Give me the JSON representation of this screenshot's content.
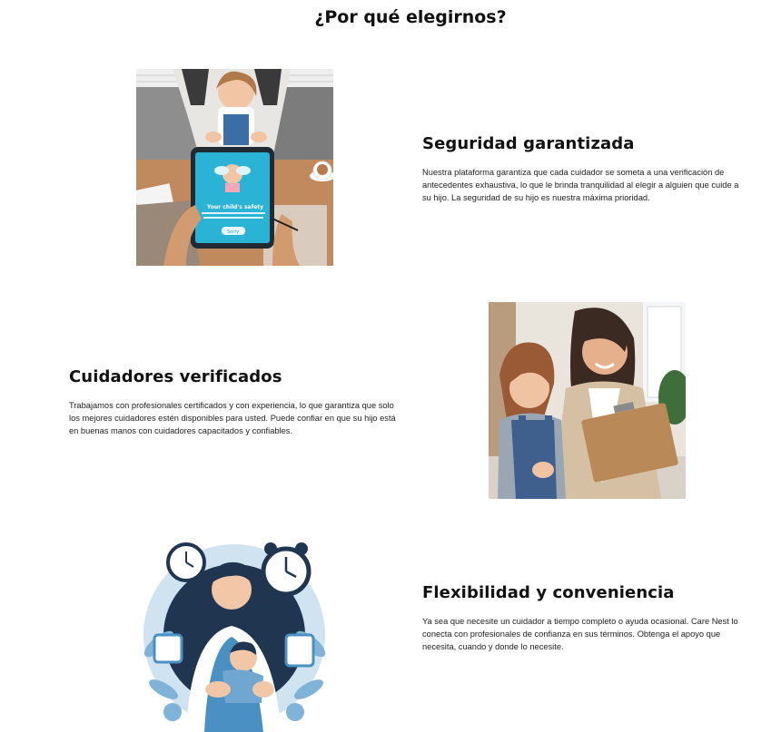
{
  "section": {
    "title": "¿Por qué elegirnos?"
  },
  "features": [
    {
      "heading": "Seguridad garantizada",
      "text": "Nuestra plataforma garantiza que cada cuidador se someta a una verificación de antecedentes exhaustiva, lo que le brinda tranquilidad al elegir a alguien que cuide a su hijo. La seguridad de su hijo es nuestra máxima prioridad.",
      "image": "parent-tablet-child-safety-photo",
      "tablet_text": {
        "title": "Your child's safety",
        "button": "Sorry"
      }
    },
    {
      "heading": "Cuidadores verificados",
      "text": "Trabajamos con profesionales certificados y con experiencia, lo que garantiza que solo los mejores cuidadores estén disponibles para usted. Puede confiar en que su hijo está en buenas manos con cuidadores capacitados y confiables.",
      "image": "caregiver-with-clipboard-and-girl-photo"
    },
    {
      "heading": "Flexibilidad y conveniencia",
      "text": "Ya sea que necesite un cuidador a tiempo completo o ayuda ocasional. Care Nest lo conecta con profesionales de confianza en sus términos. Obtenga el apoyo que necesita, cuando y donde lo necesite.",
      "image": "father-holding-baby-with-clocks-illustration"
    }
  ],
  "colors": {
    "text": "#111111",
    "tablet_screen": "#2bb3d6",
    "illustration_blue": "#4a90c2",
    "illustration_dark": "#1f3550"
  }
}
